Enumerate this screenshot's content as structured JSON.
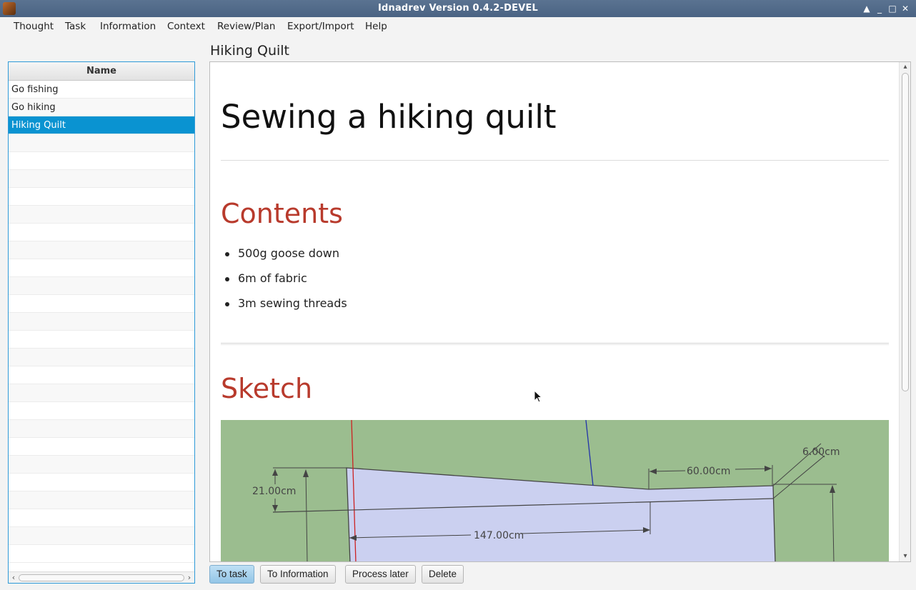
{
  "window": {
    "title": "Idnadrev Version 0.4.2-DEVEL"
  },
  "menu": [
    "Thought",
    "Task",
    "Information",
    "Context",
    "Review/Plan",
    "Export/Import",
    "Help"
  ],
  "list": {
    "header": "Name",
    "items": [
      "Go fishing",
      "Go hiking",
      "Hiking Quilt"
    ],
    "selected": "Hiking Quilt"
  },
  "detail": {
    "title": "Hiking Quilt",
    "heading": "Sewing a hiking quilt",
    "contents_heading": "Contents",
    "contents": [
      "500g goose down",
      "6m of fabric",
      "3m sewing threads"
    ],
    "sketch_heading": "Sketch",
    "sketch_labels": {
      "dim_width": "60.00cm",
      "dim_corner": "6.00cm",
      "dim_height": "21.00cm",
      "dim_length": "147.00cm"
    }
  },
  "buttons": {
    "to_task": "To task",
    "to_information": "To Information",
    "process_later": "Process later",
    "delete": "Delete"
  },
  "colors": {
    "accent": "#0a93d1",
    "heading_red": "#b83a2c",
    "sketch_background": "#9bbd8f",
    "sketch_shape": "#cbd0f0"
  }
}
